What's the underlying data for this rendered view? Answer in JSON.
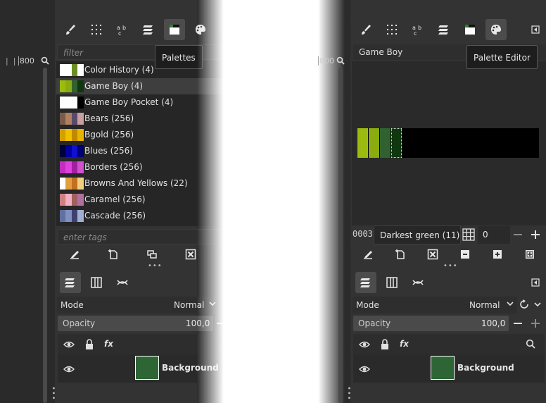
{
  "left_panel": {
    "ruler_label": "800",
    "filter_placeholder": "filter",
    "tooltip": "Palettes",
    "palettes": [
      {
        "label": "Color History (4)",
        "colors": [
          "#ffffff",
          "#ffffff",
          "#6b8e23",
          "#ffffff"
        ]
      },
      {
        "label": "Game Boy (4)",
        "colors": [
          "#9bbc0f",
          "#8bac0f",
          "#306230",
          "#0f380f"
        ]
      },
      {
        "label": "Game Boy Pocket (4)",
        "colors": [
          "#ffffff",
          "#ffffff",
          "#ffffff",
          "#000000"
        ]
      },
      {
        "label": "Bears (256)",
        "colors": [
          "#7a5b4a",
          "#b08060",
          "#5a4a6a",
          "#c9a0a0"
        ]
      },
      {
        "label": "Bgold (256)",
        "colors": [
          "#d4a000",
          "#f0c000",
          "#c08a00",
          "#e8b400"
        ]
      },
      {
        "label": "Blues (256)",
        "colors": [
          "#00003a",
          "#0000a0",
          "#1010d0",
          "#000070"
        ]
      },
      {
        "label": "Borders (256)",
        "colors": [
          "#c030c0",
          "#e040e0",
          "#a020a0",
          "#d050d0"
        ]
      },
      {
        "label": "Browns And Yellows (22)",
        "colors": [
          "#ffffff",
          "#e0a040",
          "#c07020",
          "#f0d080"
        ]
      },
      {
        "label": "Caramel (256)",
        "colors": [
          "#d08080",
          "#f0b0c0",
          "#a06060",
          "#b070a0"
        ]
      },
      {
        "label": "Cascade (256)",
        "colors": [
          "#6070a0",
          "#8090c0",
          "#404070",
          "#a0b0d0"
        ]
      }
    ],
    "tags_placeholder": "enter tags",
    "layers": {
      "mode_label": "Mode",
      "mode_value": "Normal",
      "opacity_label": "Opacity",
      "opacity_value": "100,0",
      "layer_name": "Background",
      "layer_color": "#2e6535"
    }
  },
  "right_panel": {
    "ruler_label": "800",
    "palette_name": "Game Boy",
    "tooltip": "Palette Editor",
    "swatches": [
      "#9bbc0f",
      "#8bac0f",
      "#306230",
      "#0f380f"
    ],
    "index_value": "0003",
    "color_name": "Darkest green (11)",
    "columns_value": "0",
    "layers": {
      "mode_label": "Mode",
      "mode_value": "Normal",
      "opacity_label": "Opacity",
      "opacity_value": "100,0",
      "layer_name": "Background",
      "layer_color": "#2e6535"
    }
  }
}
